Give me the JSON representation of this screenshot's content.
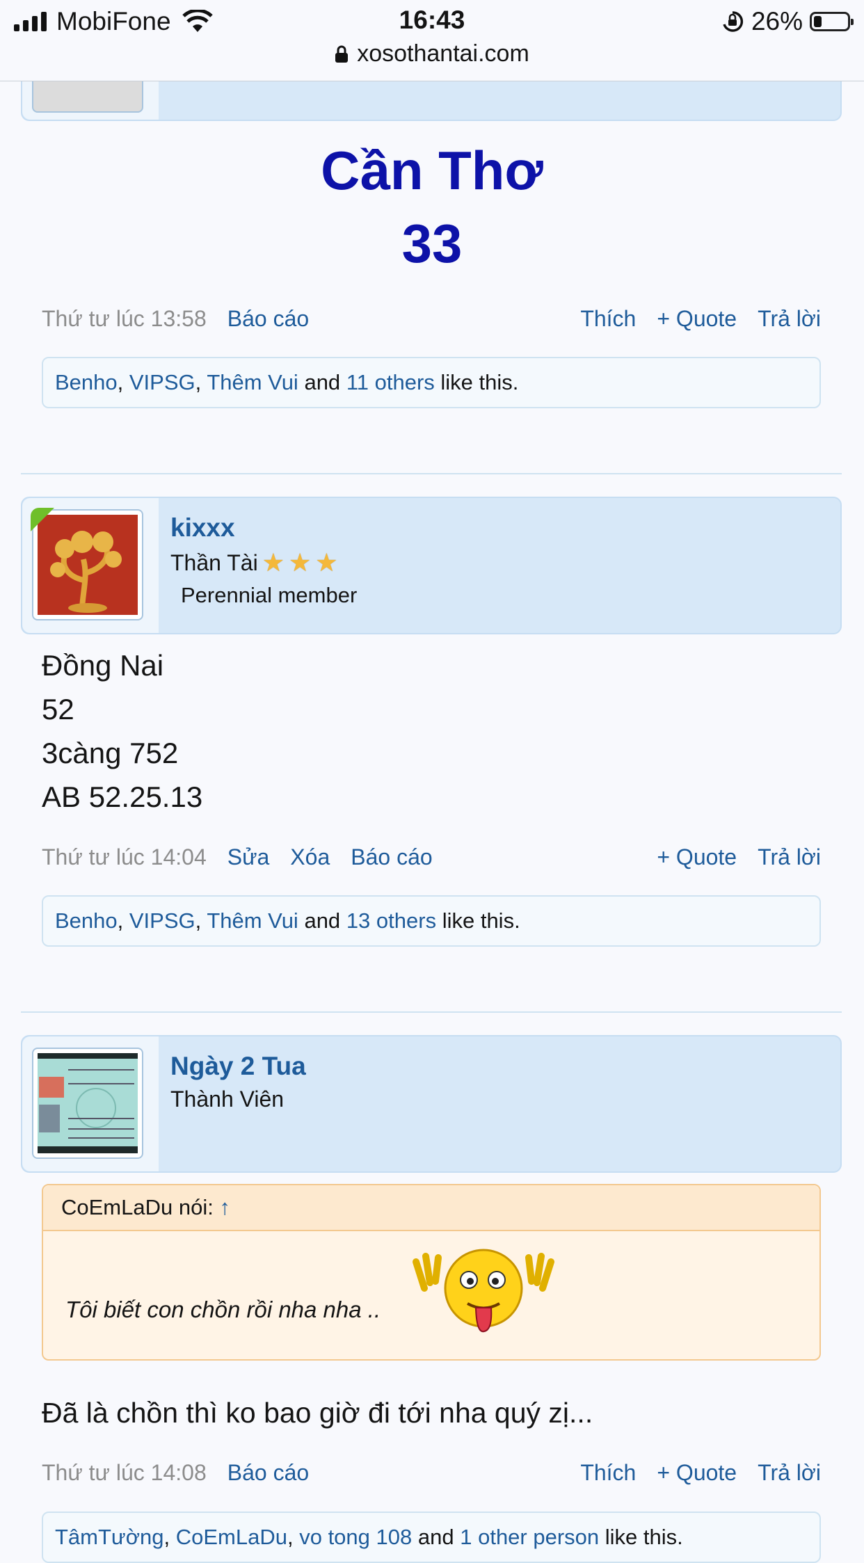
{
  "status": {
    "carrier": "MobiFone",
    "time": "16:43",
    "battery": "26%",
    "url": "xosothantai.com",
    "icons": [
      "signal-icon",
      "wifi-icon",
      "orientation-lock-icon",
      "battery-icon",
      "lock-icon"
    ]
  },
  "post1": {
    "city": "Cần Thơ",
    "number": "33",
    "date": "Thứ tư lúc 13:58",
    "report": "Báo cáo",
    "like": "Thích",
    "quote": "+ Quote",
    "reply": "Trả lời",
    "likes": {
      "u1": "Benho",
      "u2": "VIPSG",
      "u3": "Thêm Vui",
      "and": "and",
      "others": "11 others",
      "tail": "like this."
    }
  },
  "post2": {
    "username": "kixxx",
    "rank": "Thần Tài",
    "member": "Perennial member",
    "lines": [
      "Đồng Nai",
      "52",
      "3càng 752",
      "AB 52.25.13"
    ],
    "date": "Thứ tư lúc 14:04",
    "edit": "Sửa",
    "delete": "Xóa",
    "report": "Báo cáo",
    "quote": "+ Quote",
    "reply": "Trả lời",
    "likes": {
      "u1": "Benho",
      "u2": "VIPSG",
      "u3": "Thêm Vui",
      "and": "and",
      "others": "13 others",
      "tail": "like this."
    }
  },
  "post3": {
    "username": "Ngày 2 Tua",
    "rank": "Thành Viên",
    "quote_author": "CoEmLaDu nói:",
    "quote_arrow": "↑",
    "quote_text": "Tôi biết con chồn rồi nha nha ..",
    "text": "Đã là chồn thì ko bao giờ đi tới nha quý zị...",
    "date": "Thứ tư lúc 14:08",
    "report": "Báo cáo",
    "like": "Thích",
    "quote": "+ Quote",
    "reply": "Trả lời",
    "likes": {
      "u1": "TâmTường",
      "u2": "CoEmLaDu",
      "u3": "vo tong 108",
      "and": "and",
      "others": "1 other person",
      "tail": "like this."
    }
  }
}
